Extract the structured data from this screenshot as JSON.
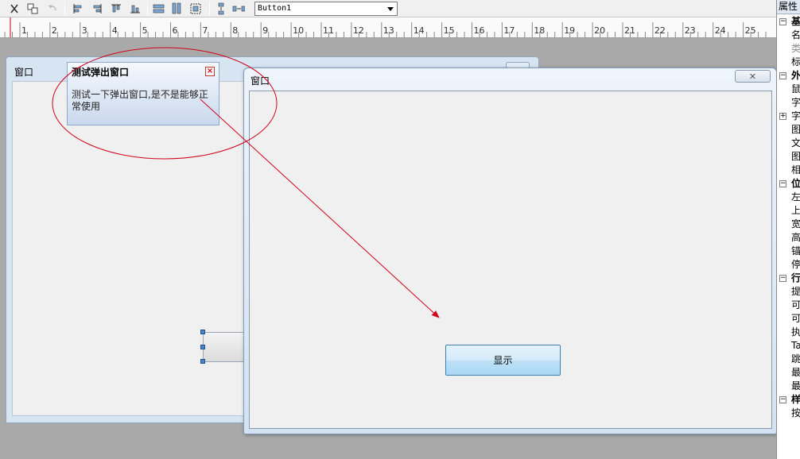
{
  "toolbar": {
    "combo_value": "Button1",
    "icons": [
      "cut-icon",
      "copy-icon",
      "undo-icon",
      "align-left-icon",
      "align-right-icon",
      "align-top-icon",
      "align-bottom-icon",
      "same-width-icon",
      "same-height-icon",
      "same-size-icon",
      "vertical-spacing-icon",
      "horizontal-spacing-icon"
    ]
  },
  "ruler": {
    "labels": [
      "1",
      "2",
      "3",
      "4",
      "5",
      "6",
      "7",
      "8",
      "9",
      "10",
      "11",
      "12",
      "13",
      "14",
      "15",
      "16",
      "17",
      "18",
      "19",
      "20",
      "21",
      "22",
      "23",
      "24",
      "25"
    ]
  },
  "design_window": {
    "title": "窗口"
  },
  "popup": {
    "title": "测试弹出窗口",
    "close_glyph": "×",
    "body": "测试一下弹出窗口,是不是能够正常使用"
  },
  "preview_window": {
    "title": "窗口",
    "close_glyph": "✕",
    "button_label": "显示"
  },
  "properties": {
    "header": "属性",
    "rows": [
      {
        "kind": "cat",
        "label": "基"
      },
      {
        "kind": "item",
        "label": "名"
      },
      {
        "kind": "item",
        "label": "类",
        "dim": true
      },
      {
        "kind": "item",
        "label": "标"
      },
      {
        "kind": "cat",
        "label": "外"
      },
      {
        "kind": "item",
        "label": "鼠"
      },
      {
        "kind": "item",
        "label": "字"
      },
      {
        "kind": "sub",
        "label": "字"
      },
      {
        "kind": "item",
        "label": "图"
      },
      {
        "kind": "item",
        "label": "文"
      },
      {
        "kind": "item",
        "label": "图"
      },
      {
        "kind": "item",
        "label": "相"
      },
      {
        "kind": "cat",
        "label": "位"
      },
      {
        "kind": "item",
        "label": "左"
      },
      {
        "kind": "item",
        "label": "上"
      },
      {
        "kind": "item",
        "label": "宽"
      },
      {
        "kind": "item",
        "label": "高"
      },
      {
        "kind": "item",
        "label": "锚"
      },
      {
        "kind": "item",
        "label": "停"
      },
      {
        "kind": "cat",
        "label": "行"
      },
      {
        "kind": "item",
        "label": "提"
      },
      {
        "kind": "item",
        "label": "可"
      },
      {
        "kind": "item",
        "label": "可"
      },
      {
        "kind": "item",
        "label": "执"
      },
      {
        "kind": "item",
        "label": "Ta"
      },
      {
        "kind": "item",
        "label": "跳"
      },
      {
        "kind": "item",
        "label": "最"
      },
      {
        "kind": "item",
        "label": "最"
      },
      {
        "kind": "cat",
        "label": "样"
      },
      {
        "kind": "item",
        "label": "按"
      }
    ]
  },
  "annotation": {
    "color": "#d0021b"
  }
}
